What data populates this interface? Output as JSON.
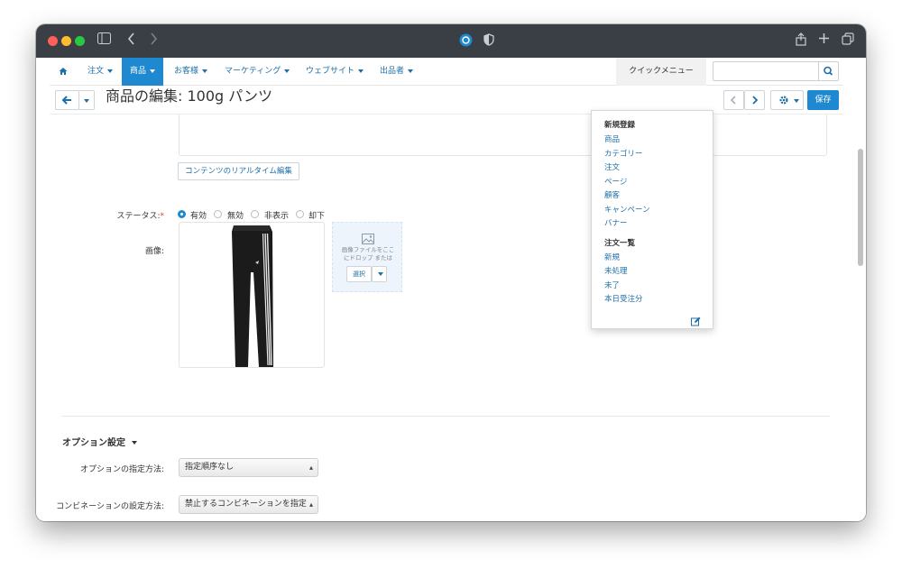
{
  "navbar": {
    "items": [
      {
        "label": "注文"
      },
      {
        "label": "商品"
      },
      {
        "label": "お客様"
      },
      {
        "label": "マーケティング"
      },
      {
        "label": "ウェブサイト"
      },
      {
        "label": "出品者"
      }
    ],
    "quick_menu_label": "クイックメニュー",
    "search_value": ""
  },
  "toolbar": {
    "title": "商品の編集: 100g パンツ",
    "save_label": "保存"
  },
  "form": {
    "realtime_edit_label": "コンテンツのリアルタイム編集",
    "status_label": "ステータス:",
    "required_mark": "*",
    "status_options": [
      {
        "label": "有効",
        "selected": true
      },
      {
        "label": "無効",
        "selected": false
      },
      {
        "label": "非表示",
        "selected": false
      },
      {
        "label": "却下",
        "selected": false
      }
    ],
    "image_label": "画像:",
    "dropzone_text_1": "画像ファイルをここ",
    "dropzone_text_2": "にドロップ または",
    "dropzone_select_label": "選択"
  },
  "options": {
    "heading": "オプション設定",
    "method_label": "オプションの指定方法:",
    "method_value": "指定順序なし",
    "combination_label": "コンビネーションの設定方法:",
    "combination_value": "禁止するコンビネーションを指定"
  },
  "quick_menu": {
    "section1_title": "新規登録",
    "section1_items": [
      "商品",
      "カテゴリー",
      "注文",
      "ページ",
      "顧客",
      "キャンペーン",
      "バナー"
    ],
    "section2_title": "注文一覧",
    "section2_items": [
      "新規",
      "未処理",
      "未了",
      "本日受注分"
    ]
  },
  "colors": {
    "accent": "#1e88d0",
    "link": "#1d6fa8",
    "titlebar": "#3a3f46"
  }
}
